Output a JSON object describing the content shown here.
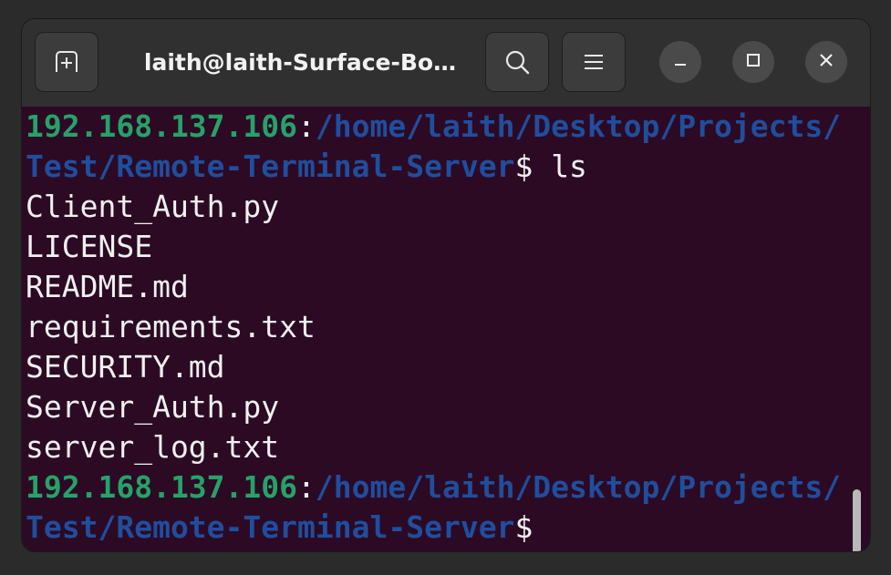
{
  "window": {
    "title": "laith@laith-Surface-Bo…"
  },
  "icons": {
    "new_tab": "new-tab-icon",
    "search": "search-icon",
    "menu": "hamburger-menu-icon",
    "minimize": "minimize-icon",
    "maximize": "maximize-icon",
    "close": "close-icon"
  },
  "colors": {
    "terminal_bg": "#2c0a24",
    "host": "#26a269",
    "path": "#1f4e9e",
    "text": "#f0f0f0"
  },
  "terminal": {
    "prompt1": {
      "host": "192.168.137.106",
      "sep": ":",
      "path_line1": "/home/laith/Desktop/Projects/",
      "path_line2": "Test/Remote-Terminal-Server",
      "symbol": "$ ",
      "command": "ls"
    },
    "output": [
      "Client_Auth.py",
      "LICENSE",
      "README.md",
      "requirements.txt",
      "SECURITY.md",
      "Server_Auth.py",
      "server_log.txt"
    ],
    "prompt2": {
      "host": "192.168.137.106",
      "sep": ":",
      "path_line1": "/home/laith/Desktop/Projects/",
      "path_line2": "Test/Remote-Terminal-Server",
      "symbol": "$"
    }
  }
}
